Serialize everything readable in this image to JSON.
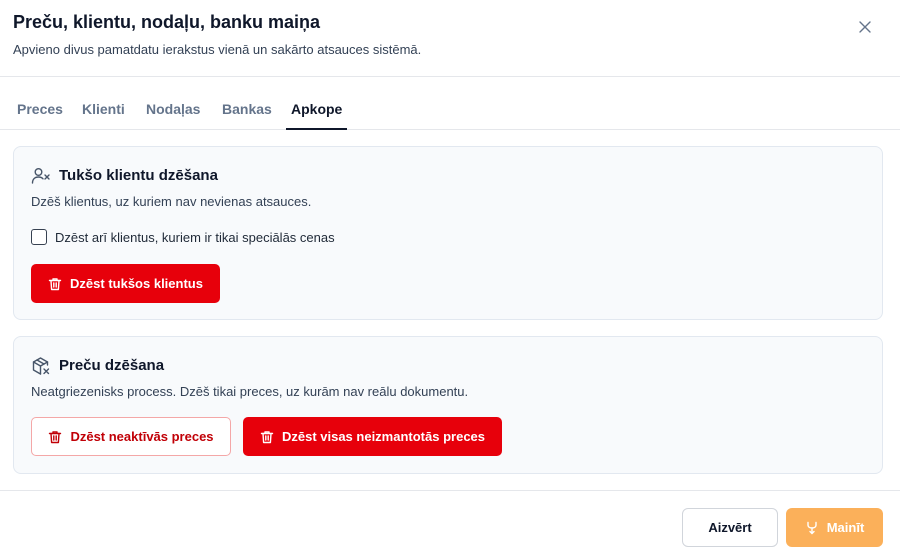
{
  "dialog": {
    "title": "Preču, klientu, nodaļu, banku maiņa",
    "subtitle": "Apvieno divus pamatdatu ierakstus vienā un sakārto atsauces sistēmā."
  },
  "tabs": [
    {
      "label": "Preces"
    },
    {
      "label": "Klienti"
    },
    {
      "label": "Nodaļas"
    },
    {
      "label": "Bankas"
    },
    {
      "label": "Apkope"
    }
  ],
  "active_tab": "Apkope",
  "clients_section": {
    "icon": "user-x-icon",
    "title": "Tukšo klientu dzēšana",
    "description": "Dzēš klientus, uz kuriem nav nevienas atsauces.",
    "checkbox_label": "Dzēst arī klientus, kuriem ir tikai speciālās cenas",
    "checkbox_checked": false,
    "delete_button": "Dzēst tukšos klientus"
  },
  "products_section": {
    "icon": "package-x-icon",
    "title": "Preču dzēšana",
    "description": "Neatgriezenisks process. Dzēš tikai preces, uz kurām nav reālu dokumentu.",
    "delete_inactive_button": "Dzēst neaktīvās preces",
    "delete_unused_button": "Dzēst visas neizmantotās preces"
  },
  "footer": {
    "close_button": "Aizvērt",
    "submit_button": "Mainīt"
  },
  "colors": {
    "danger": "#e7000b",
    "primary_disabled": "#fbb05a",
    "text": "#0f172a"
  }
}
